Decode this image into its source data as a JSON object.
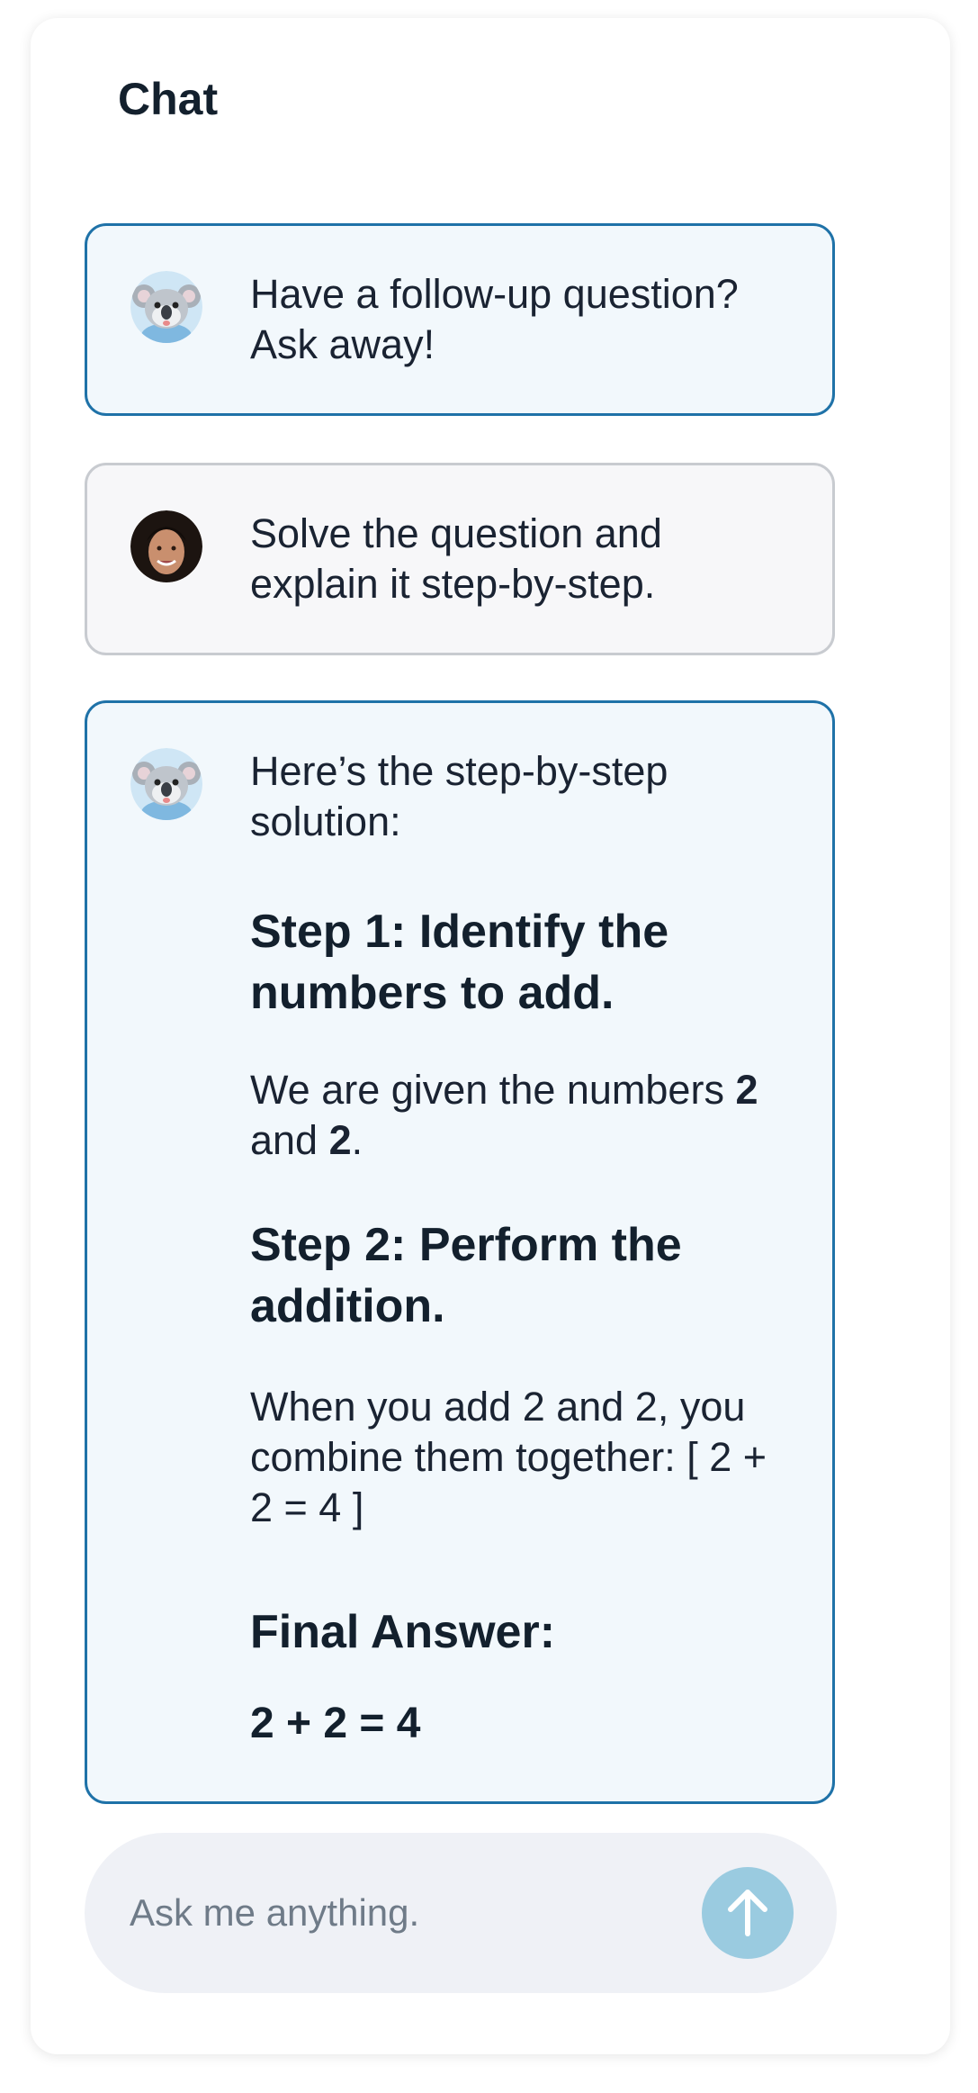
{
  "header": {
    "title": "Chat"
  },
  "messages": [
    {
      "role": "assistant",
      "avatar": "koala-avatar",
      "text": "Have a follow-up question? Ask away!"
    },
    {
      "role": "user",
      "avatar": "user-avatar",
      "text": "Solve the question and explain it step-by-step."
    },
    {
      "role": "assistant",
      "avatar": "koala-avatar",
      "intro": "Here’s the step-by-step solution:",
      "step1_heading": "Step 1: Identify the numbers to add.",
      "step1_prefix": "We are given the numbers ",
      "step1_num_a": "2",
      "step1_mid": " and ",
      "step1_num_b": "2",
      "step1_suffix": ".",
      "step2_heading": "Step 2: Perform the addition.",
      "step2_text": "When you add 2 and 2, you combine them together: [ 2 + 2 = 4 ]",
      "final_heading": "Final Answer:",
      "final_value": "2 + 2 = 4"
    }
  ],
  "composer": {
    "placeholder": "Ask me anything.",
    "send_icon": "arrow-up-icon"
  },
  "colors": {
    "assistant_border": "#1f72a8",
    "assistant_bg": "#f2f8fc",
    "user_border": "#c8cbd0",
    "user_bg": "#f7f7f9",
    "send_button": "#9acbe0",
    "input_bg": "#eff1f6"
  }
}
